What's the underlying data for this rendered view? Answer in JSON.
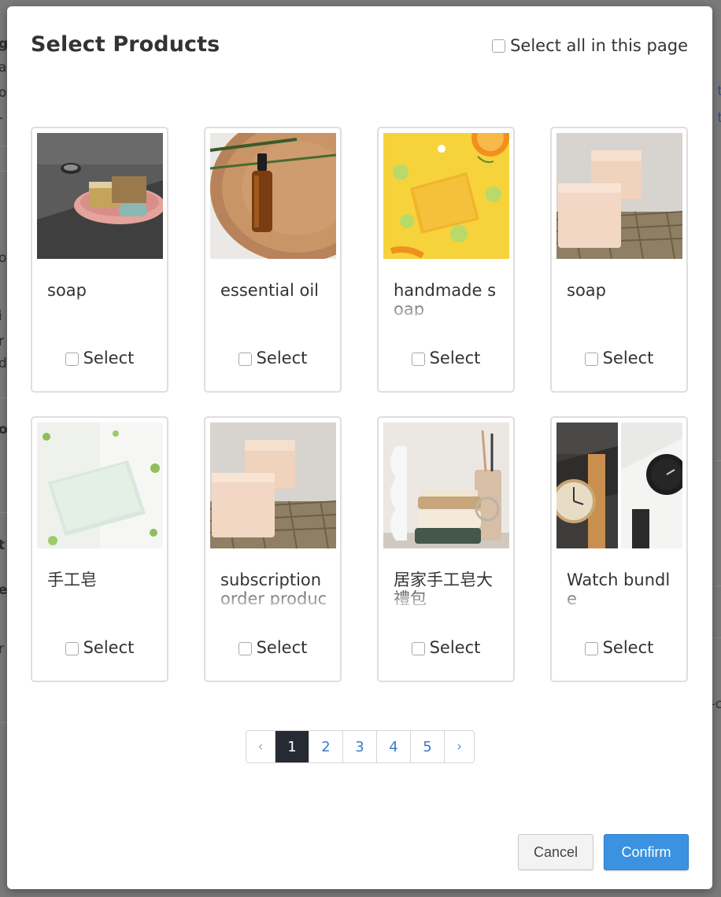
{
  "dialog": {
    "title": "Select Products",
    "select_all_label": "Select all in this page"
  },
  "background_glyphs": [
    "g",
    "a",
    "o",
    "-",
    "o",
    "is",
    "r",
    "d",
    "o",
    "t",
    "e",
    "ri",
    "t",
    "t",
    "t",
    "-c"
  ],
  "products": [
    {
      "name": "soap",
      "select_label": "Select",
      "image": "soap-dish-icon"
    },
    {
      "name": "essential oil",
      "select_label": "Select",
      "image": "dropper-bottle-icon"
    },
    {
      "name": "handmade soap",
      "select_label": "Select",
      "image": "yellow-soap-citrus-icon"
    },
    {
      "name": "soap",
      "select_label": "Select",
      "image": "soap-bars-net-icon"
    },
    {
      "name": "手工皂",
      "select_label": "Select",
      "image": "white-soap-bar-icon"
    },
    {
      "name": "subscription order product-soap",
      "select_label": "Select",
      "image": "soap-bars-net-icon"
    },
    {
      "name": "居家手工皂大禮包",
      "select_label": "Select",
      "image": "bathroom-soap-set-icon"
    },
    {
      "name": "Watch bundle",
      "select_label": "Select",
      "image": "watch-pair-icon"
    }
  ],
  "pagination": {
    "prev": "‹",
    "pages": [
      "1",
      "2",
      "3",
      "4",
      "5"
    ],
    "current": "1",
    "next": "›"
  },
  "actions": {
    "cancel_label": "Cancel",
    "confirm_label": "Confirm"
  },
  "colors": {
    "accent": "#3a92e0",
    "active_page": "#262b33",
    "overlay": "#7a7a7a"
  }
}
